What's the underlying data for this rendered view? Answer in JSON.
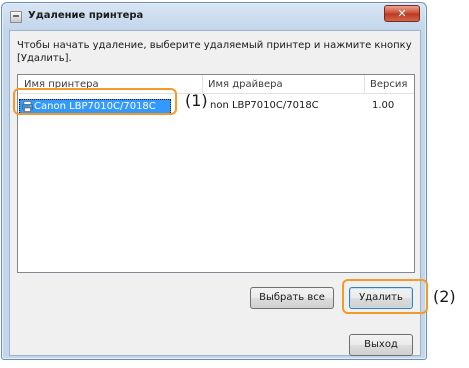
{
  "dialog": {
    "title": "Удаление принтера",
    "close_glyph": "✕",
    "close_icon": "close-icon",
    "instruction": "Чтобы начать удаление, выберите удаляемый принтер и нажмите кнопку [Удалить]."
  },
  "printer_list": {
    "columns": [
      "Имя принтера",
      "Имя драйвера",
      "Версия"
    ],
    "rows": [
      {
        "printer_name": "Canon LBP7010C/7018C",
        "driver_name": "non LBP7010C/7018C",
        "version": "1.00",
        "selected": true
      }
    ]
  },
  "buttons": {
    "select_all": "Выбрать все",
    "delete": "Удалить",
    "exit": "Выход"
  },
  "callouts": {
    "one": "(1)",
    "two": "(2)"
  },
  "colors": {
    "highlight": "#f39a2c",
    "selection": "#3399ff"
  }
}
